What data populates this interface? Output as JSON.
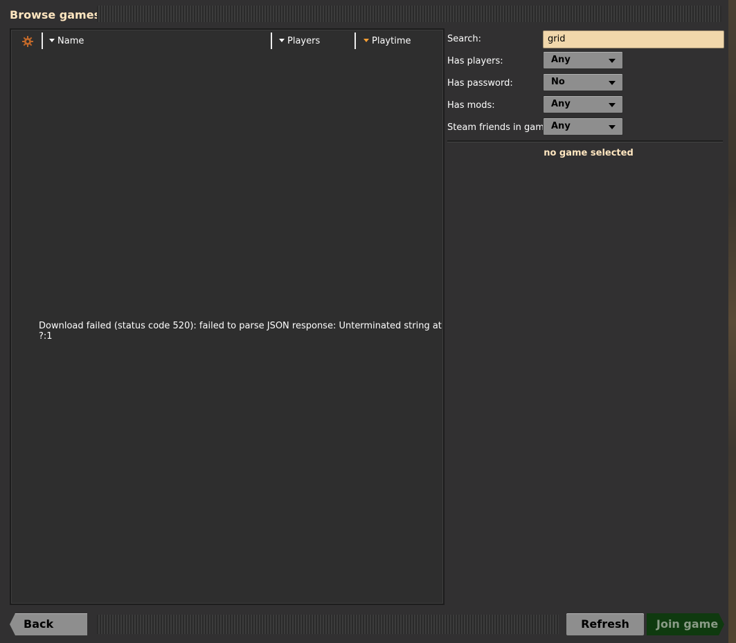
{
  "window": {
    "title": "Browse games"
  },
  "list": {
    "settings_icon": "gear-icon",
    "columns": [
      {
        "label": "Name",
        "sort_icon": "sort-triangle-icon"
      },
      {
        "label": "Players",
        "sort_icon": "sort-triangle-icon"
      },
      {
        "label": "Playtime",
        "sort_icon": "sort-triangle-active-icon"
      }
    ],
    "error_message": "Download failed (status code 520): failed to parse JSON response: Unterminated string at ?:1"
  },
  "filters": {
    "search_label": "Search:",
    "search_value": "grid",
    "has_players_label": "Has players:",
    "has_players_value": "Any",
    "has_password_label": "Has password:",
    "has_password_value": "No",
    "has_mods_label": "Has mods:",
    "has_mods_value": "Any",
    "steam_friends_label": "Steam friends in game:",
    "steam_friends_value": "Any"
  },
  "details": {
    "no_selection": "no game selected"
  },
  "buttons": {
    "back": "Back",
    "refresh": "Refresh",
    "join": "Join game"
  },
  "colors": {
    "accent": "#ffe6c0",
    "active_sort": "#ffa135",
    "search_bg": "#f1d7ab",
    "join_bg": "#0f3a0f"
  }
}
